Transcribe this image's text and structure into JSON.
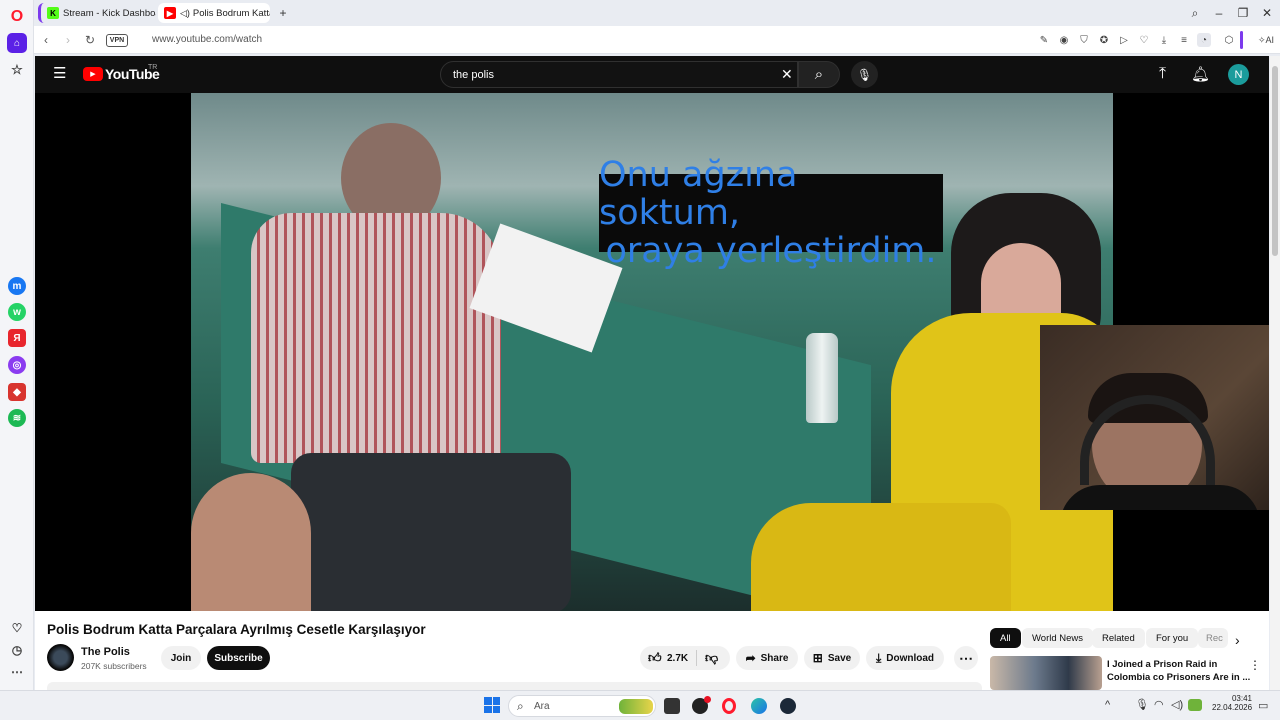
{
  "tabs": [
    {
      "label": "Stream - Kick Dashboard",
      "icon": "kick-icon"
    },
    {
      "label": "Polis Bodrum Katta Pa",
      "icon": "youtube-icon"
    }
  ],
  "address": {
    "url": "www.youtube.com/watch",
    "vpn_label": "VPN",
    "ai_label": "AI"
  },
  "youtube": {
    "logo": "YouTube",
    "region": "TR",
    "search_value": "the polis",
    "avatar_letter": "N",
    "subtitle_line1": "Onu ağzına soktum,",
    "subtitle_line2": "oraya yerleştirdim.",
    "video_title": "Polis Bodrum Katta Parçalara Ayrılmış Cesetle Karşılaşıyor",
    "channel_name": "The Polis",
    "subscribers": "207K subscribers",
    "join_label": "Join",
    "subscribe_label": "Subscribe",
    "likes": "2.7K",
    "share_label": "Share",
    "save_label": "Save",
    "download_label": "Download",
    "chips": [
      "All",
      "World News",
      "Related",
      "For you",
      "Rec"
    ],
    "rec_title_line1": "I Joined a Prison Raid in",
    "rec_title_line2": "Colombia co Prisoners Are in ..."
  },
  "taskbar": {
    "search_placeholder": "Ara",
    "time": "03:41",
    "date": "22.04.2026"
  },
  "colors": {
    "youtube_red": "#ff0000",
    "opera_red": "#ff1b2d",
    "subscribe_bg": "#0f0f0f",
    "subtitle_text": "#2f7fe6"
  }
}
